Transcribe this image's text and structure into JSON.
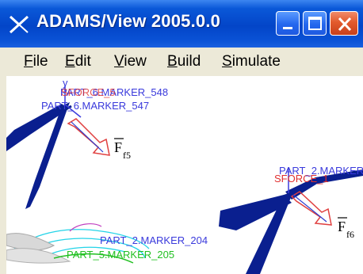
{
  "window": {
    "title": "ADAMS/View 2005.0.0",
    "controls": {
      "minimize_icon": "minimize-icon",
      "maximize_icon": "maximize-icon",
      "close_icon": "close-icon"
    }
  },
  "menu": {
    "items": [
      {
        "accel": "F",
        "rest": "ile"
      },
      {
        "accel": "E",
        "rest": "dit"
      },
      {
        "accel": "V",
        "rest": "iew"
      },
      {
        "accel": "B",
        "rest": "uild"
      },
      {
        "accel": "S",
        "rest": "imulate"
      }
    ]
  },
  "viewport": {
    "labels": {
      "marker_548": "PART_6.MARKER_548",
      "marker_547": "PART_6.MARKER_547",
      "force_f5_main": "F",
      "force_f5_sub": "f5",
      "sforce_right": "SFORCE_1",
      "part_marker_right": "PART_2.MARKER",
      "force_f6_main": "F",
      "force_f6_sub": "f6",
      "marker_204": "PART_2.MARKER_204",
      "marker_205": "PART_5.MARKER_205"
    },
    "colors": {
      "link": "#0a1f8f",
      "marker_text": "#3a3adc",
      "sforce_text": "#e03030",
      "force_arrow": "#e04040",
      "green_text": "#22c022",
      "cyan_part": "#24d4e8"
    }
  }
}
